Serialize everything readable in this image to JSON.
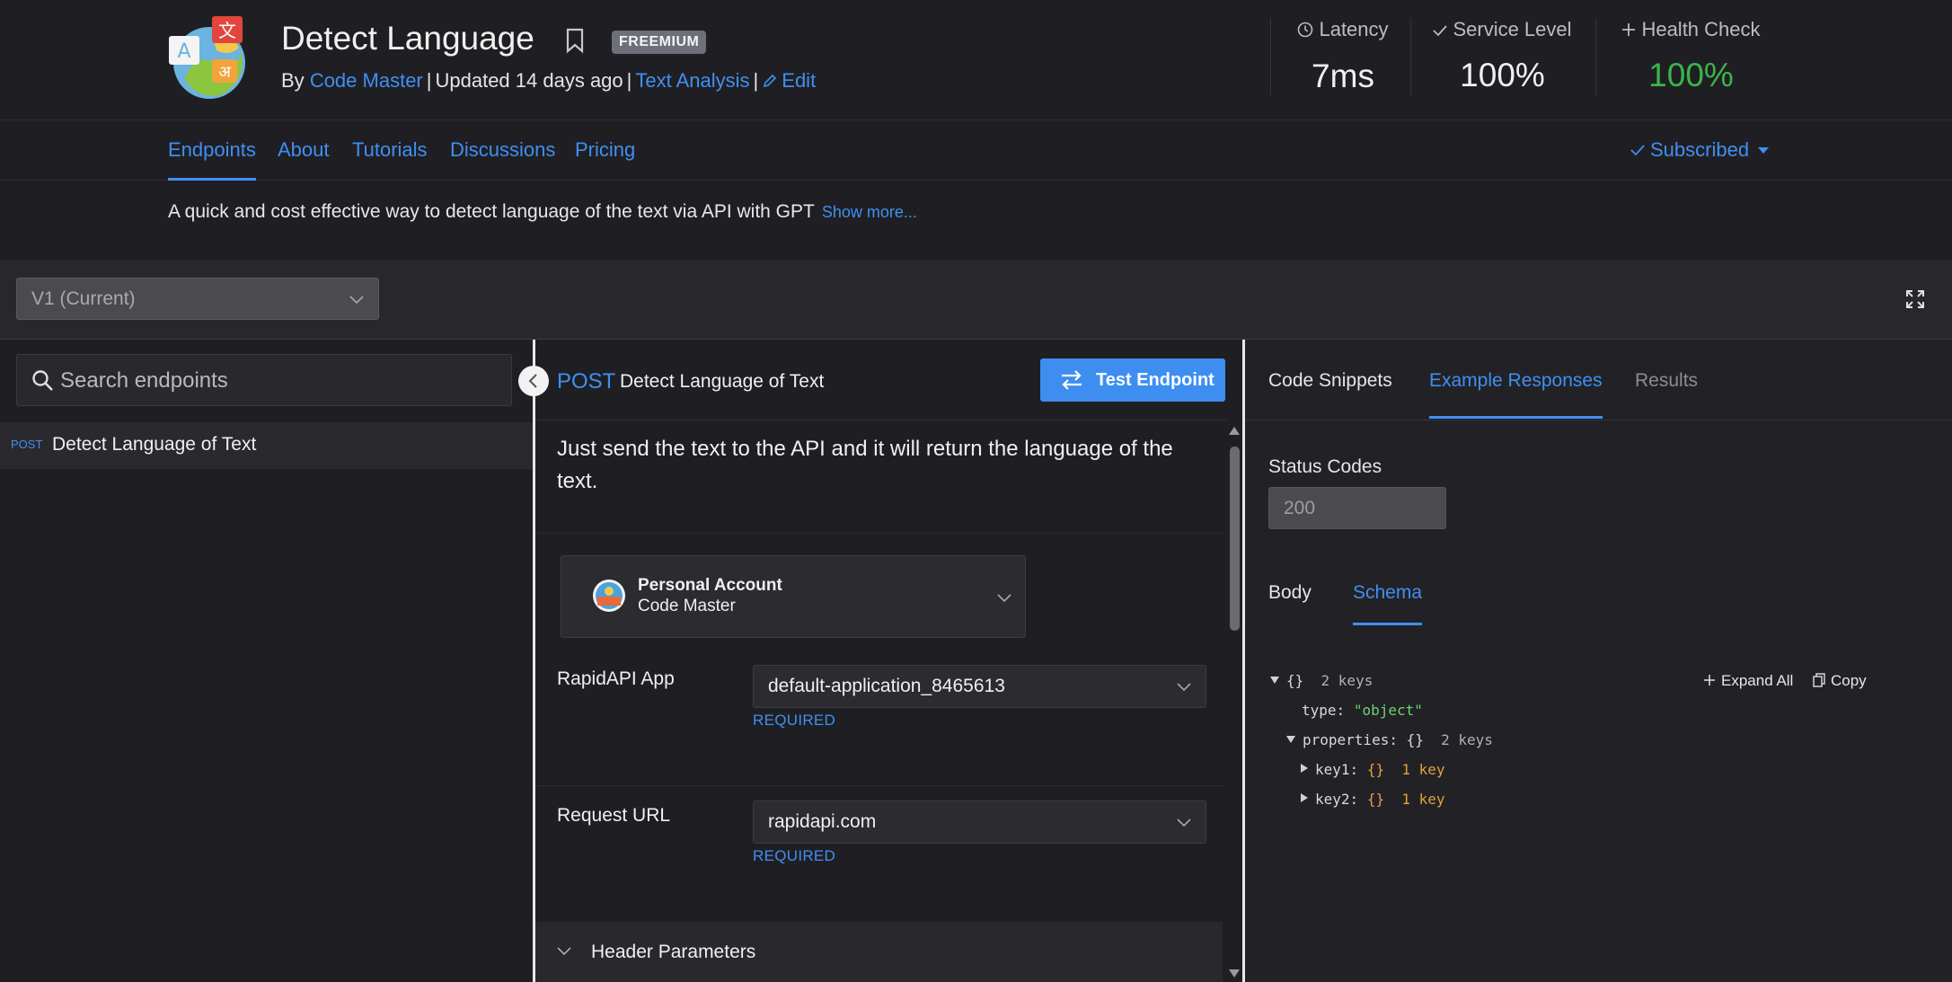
{
  "header": {
    "title": "Detect Language",
    "badge": "FREEMIUM",
    "by_prefix": "By",
    "author": "Code Master",
    "updated": "Updated 14 days ago",
    "category": "Text Analysis",
    "edit_label": "Edit",
    "logo_glyphs": {
      "a": "A",
      "zh": "文",
      "hi": "अ"
    }
  },
  "stats": {
    "latency": {
      "label": "Latency",
      "value": "7ms",
      "icon": "clock-icon"
    },
    "service_level": {
      "label": "Service Level",
      "value": "100%",
      "icon": "check-icon"
    },
    "health_check": {
      "label": "Health Check",
      "value": "100%",
      "icon": "plus-icon",
      "color": "#3ab54a"
    }
  },
  "nav": {
    "tabs": [
      {
        "label": "Endpoints",
        "active": true
      },
      {
        "label": "About"
      },
      {
        "label": "Tutorials"
      },
      {
        "label": "Discussions"
      },
      {
        "label": "Pricing"
      }
    ],
    "subscribed_label": "Subscribed"
  },
  "description": {
    "text": "A quick and cost effective way to detect language of the text via API with GPT",
    "show_more": "Show more..."
  },
  "version": {
    "selected": "V1 (Current)"
  },
  "sidebar": {
    "search_placeholder": "Search endpoints",
    "endpoints": [
      {
        "method": "POST",
        "name": "Detect Language of Text"
      }
    ]
  },
  "endpoint": {
    "method": "POST",
    "title": "Detect Language of Text",
    "test_button": "Test Endpoint",
    "description": "Just send the text to the API and it will return the language of the text.",
    "account": {
      "type": "Personal Account",
      "name": "Code Master"
    },
    "rapidapi_app": {
      "label": "RapidAPI App",
      "value": "default-application_8465613",
      "required": "REQUIRED"
    },
    "request_url": {
      "label": "Request URL",
      "value": "rapidapi.com",
      "required": "REQUIRED"
    },
    "header_params": "Header Parameters"
  },
  "right": {
    "tabs": [
      "Code Snippets",
      "Example Responses",
      "Results"
    ],
    "active_tab": "Example Responses",
    "status_codes_label": "Status Codes",
    "status_code": "200",
    "body_tabs": [
      "Body",
      "Schema"
    ],
    "active_body_tab": "Schema",
    "expand_all": "Expand All",
    "copy": "Copy",
    "schema": {
      "root_braces": "{}",
      "root_count": "2 keys",
      "type_key": "type:",
      "type_value": "\"object\"",
      "properties_key": "properties:",
      "properties_braces": "{}",
      "properties_count": "2 keys",
      "key1": "key1:",
      "key2": "key2:",
      "child_braces": "{}",
      "child_count": "1 key"
    }
  },
  "colors": {
    "accent": "#3f8ff2",
    "success": "#3ab54a",
    "background": "#1f1f23"
  }
}
